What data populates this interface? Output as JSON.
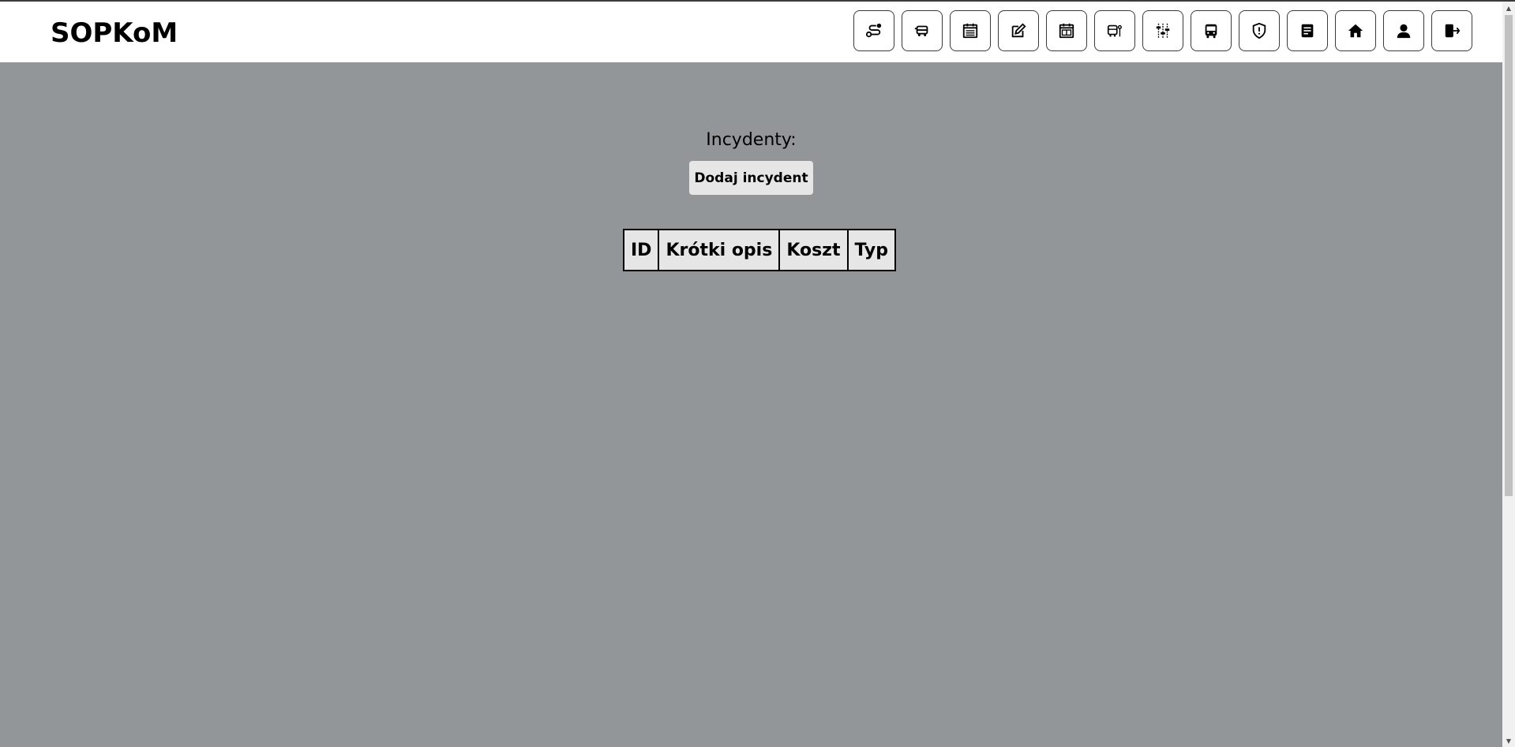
{
  "app": {
    "brand": "SOPKoM"
  },
  "nav": {
    "buttons": [
      {
        "name": "route-icon"
      },
      {
        "name": "bus-service-icon"
      },
      {
        "name": "schedule-list-icon"
      },
      {
        "name": "edit-icon"
      },
      {
        "name": "timetable-icon"
      },
      {
        "name": "bus-stop-icon"
      },
      {
        "name": "sliders-icon"
      },
      {
        "name": "bus-icon"
      },
      {
        "name": "shield-alert-icon"
      },
      {
        "name": "document-icon"
      },
      {
        "name": "home-icon"
      },
      {
        "name": "user-icon"
      },
      {
        "name": "logout-icon"
      }
    ]
  },
  "main": {
    "heading": "Incydenty:",
    "add_button": "Dodaj incydent",
    "table": {
      "columns": [
        "ID",
        "Krótki opis",
        "Koszt",
        "Typ"
      ],
      "rows": []
    }
  }
}
